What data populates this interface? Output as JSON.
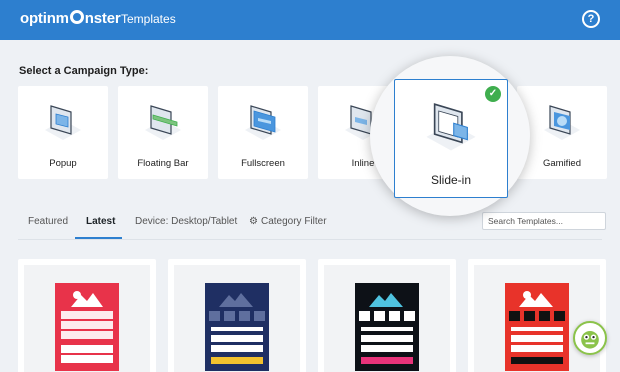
{
  "header": {
    "logo_text_1": "optinm",
    "logo_text_2": "nster",
    "title": "Templates",
    "help_icon": "?",
    "colors": {
      "bar": "#2d7fcf"
    }
  },
  "campaign": {
    "label": "Select a Campaign Type:",
    "types": [
      {
        "label": "Popup",
        "icon": "popup-icon"
      },
      {
        "label": "Floating Bar",
        "icon": "floating-bar-icon"
      },
      {
        "label": "Fullscreen",
        "icon": "fullscreen-icon"
      },
      {
        "label": "Inline",
        "icon": "inline-icon"
      },
      {
        "label": "Slide-in",
        "icon": "slide-in-icon",
        "selected": true
      },
      {
        "label": "Gamified",
        "icon": "gamified-icon"
      }
    ]
  },
  "tabs": {
    "featured": "Featured",
    "latest": "Latest",
    "device": "Device: Desktop/Tablet",
    "category": "Category Filter",
    "active": "Latest"
  },
  "search": {
    "placeholder": "Search Templates..."
  },
  "templates": [
    {
      "color": "#e8334a",
      "accent": "#e8334a",
      "name": "red-template"
    },
    {
      "color": "#1f2f63",
      "accent": "#f2c12e",
      "name": "navy-template"
    },
    {
      "color": "#0d1117",
      "accent": "#e8337a",
      "name": "dark-template"
    },
    {
      "color": "#e8332a",
      "accent": "#111111",
      "name": "red-black-template"
    }
  ]
}
